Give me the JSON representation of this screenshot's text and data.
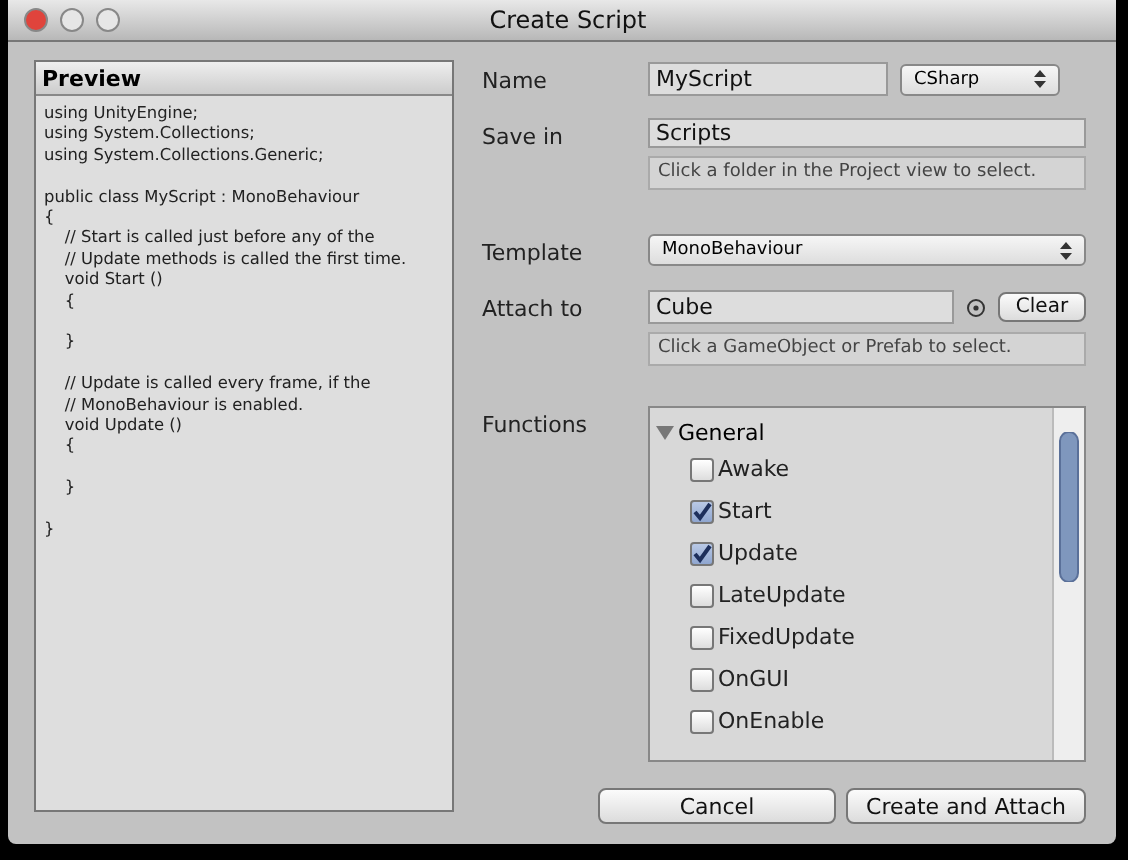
{
  "window": {
    "title": "Create Script"
  },
  "preview": {
    "title": "Preview",
    "lines": [
      {
        "kind": "code",
        "text": "using UnityEngine;"
      },
      {
        "kind": "code",
        "text": "using System.Collections;"
      },
      {
        "kind": "code",
        "text": "using System.Collections.Generic;"
      },
      {
        "kind": "blank"
      },
      {
        "kind": "code",
        "text": "public class MyScript : MonoBehaviour"
      },
      {
        "kind": "code",
        "text": "{"
      },
      {
        "kind": "code",
        "text": "    // Start is called just before any of the"
      },
      {
        "kind": "code",
        "text": "    // Update methods is called the first time."
      },
      {
        "kind": "code",
        "text": "    void Start ()"
      },
      {
        "kind": "code",
        "text": "    {"
      },
      {
        "kind": "blank"
      },
      {
        "kind": "code",
        "text": "    }"
      },
      {
        "kind": "blank"
      },
      {
        "kind": "code",
        "text": "    // Update is called every frame, if the"
      },
      {
        "kind": "code",
        "text": "    // MonoBehaviour is enabled."
      },
      {
        "kind": "code",
        "text": "    void Update ()"
      },
      {
        "kind": "code",
        "text": "    {"
      },
      {
        "kind": "blank"
      },
      {
        "kind": "code",
        "text": "    }"
      },
      {
        "kind": "blank"
      },
      {
        "kind": "code",
        "text": "}"
      }
    ]
  },
  "name": {
    "label": "Name",
    "value": "MyScript",
    "language": "CSharp"
  },
  "save_in": {
    "label": "Save in",
    "value": "Scripts",
    "hint": "Click a folder in the Project view to select."
  },
  "template": {
    "label": "Template",
    "value": "MonoBehaviour"
  },
  "attach_to": {
    "label": "Attach to",
    "value": "Cube",
    "clear": "Clear",
    "hint": "Click a GameObject or Prefab to select."
  },
  "functions": {
    "label": "Functions",
    "groups": [
      {
        "label": "General",
        "expanded": true,
        "children": [
          {
            "label": "Awake",
            "checked": false
          },
          {
            "label": "Start",
            "checked": true
          },
          {
            "label": "Update",
            "checked": true
          },
          {
            "label": "LateUpdate",
            "checked": false
          },
          {
            "label": "FixedUpdate",
            "checked": false
          },
          {
            "label": "OnGUI",
            "checked": false
          },
          {
            "label": "OnEnable",
            "checked": false
          }
        ]
      }
    ]
  },
  "buttons": [
    "Cancel",
    "Create and Attach"
  ]
}
